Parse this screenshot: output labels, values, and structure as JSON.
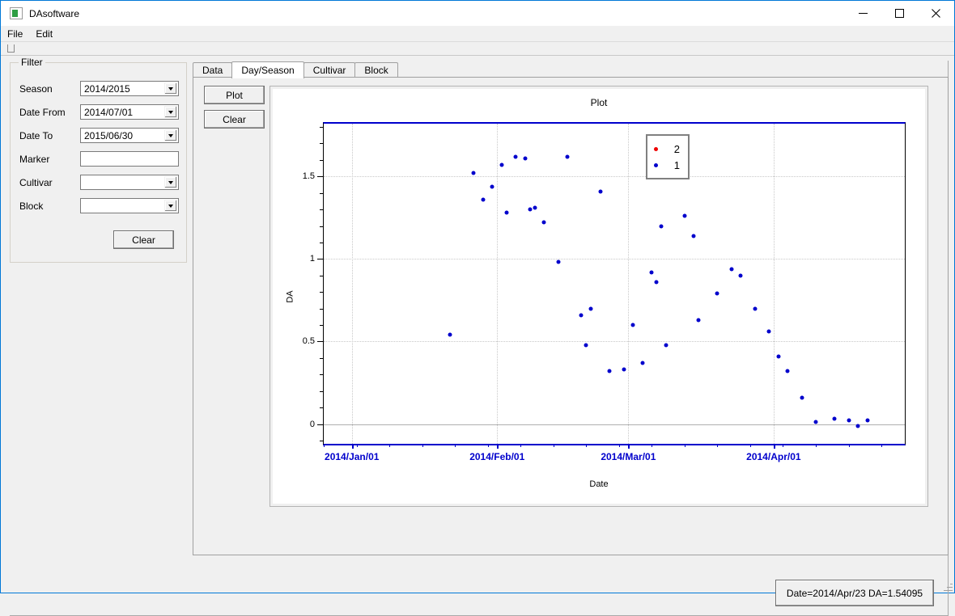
{
  "window": {
    "title": "DAsoftware",
    "icon": "app-icon",
    "minimize": "minimize-icon",
    "maximize": "maximize-icon",
    "close": "close-icon"
  },
  "menu": {
    "items": [
      "File",
      "Edit"
    ]
  },
  "filter": {
    "legend": "Filter",
    "rows": [
      {
        "label": "Season",
        "value": "2014/2015",
        "type": "combo"
      },
      {
        "label": "Date From",
        "value": "2014/07/01",
        "type": "combo"
      },
      {
        "label": "Date To",
        "value": "2015/06/30",
        "type": "combo"
      },
      {
        "label": "Marker",
        "value": "",
        "type": "text"
      },
      {
        "label": "Cultivar",
        "value": "",
        "type": "combo"
      },
      {
        "label": "Block",
        "value": "",
        "type": "combo"
      }
    ],
    "clear_label": "Clear"
  },
  "tabs": [
    {
      "label": "Data",
      "active": false
    },
    {
      "label": "Day/Season",
      "active": true
    },
    {
      "label": "Cultivar",
      "active": false
    },
    {
      "label": "Block",
      "active": false
    }
  ],
  "actions": {
    "plot_label": "Plot",
    "clear_label": "Clear"
  },
  "readout": {
    "text": "Date=2014/Apr/23  DA=1.54095"
  },
  "colors": {
    "series1": "#0000cc",
    "series2": "#ee0000",
    "axis_blue": "#0000cc",
    "grid": "#c8c8c8"
  },
  "chart_data": {
    "type": "scatter",
    "title": "Plot",
    "xlabel": "Date",
    "ylabel": "DA",
    "grid": true,
    "legend_position": "top-center-right",
    "ylim": [
      -0.12,
      1.82
    ],
    "yticks": [
      0,
      0.5,
      1,
      1.5
    ],
    "ytick_labels": [
      "0",
      "0.5",
      "1",
      "1.5"
    ],
    "xlim_days": [
      -6,
      118
    ],
    "xticks_days": [
      0,
      31,
      59,
      90
    ],
    "xtick_labels": [
      "2014/Jan/01",
      "2014/Feb/01",
      "2014/Mar/01",
      "2014/Apr/01"
    ],
    "xminor_step_days": 7,
    "series": [
      {
        "name": "2",
        "color": "#ee0000",
        "points": []
      },
      {
        "name": "1",
        "color": "#0000cc",
        "points": [
          {
            "day": 21,
            "da": 0.54
          },
          {
            "day": 26,
            "da": 1.52
          },
          {
            "day": 28,
            "da": 1.36
          },
          {
            "day": 30,
            "da": 1.44
          },
          {
            "day": 32,
            "da": 1.57
          },
          {
            "day": 33,
            "da": 1.28
          },
          {
            "day": 35,
            "da": 1.62
          },
          {
            "day": 37,
            "da": 1.61
          },
          {
            "day": 38,
            "da": 1.3
          },
          {
            "day": 39,
            "da": 1.31
          },
          {
            "day": 41,
            "da": 1.22
          },
          {
            "day": 44,
            "da": 0.98
          },
          {
            "day": 46,
            "da": 1.62
          },
          {
            "day": 49,
            "da": 0.66
          },
          {
            "day": 50,
            "da": 0.48
          },
          {
            "day": 51,
            "da": 0.7
          },
          {
            "day": 53,
            "da": 1.41
          },
          {
            "day": 55,
            "da": 0.32
          },
          {
            "day": 58,
            "da": 0.33
          },
          {
            "day": 60,
            "da": 0.6
          },
          {
            "day": 62,
            "da": 0.37
          },
          {
            "day": 64,
            "da": 0.92
          },
          {
            "day": 65,
            "da": 0.86
          },
          {
            "day": 66,
            "da": 1.2
          },
          {
            "day": 67,
            "da": 0.48
          },
          {
            "day": 71,
            "da": 1.26
          },
          {
            "day": 73,
            "da": 1.14
          },
          {
            "day": 74,
            "da": 0.63
          },
          {
            "day": 78,
            "da": 0.79
          },
          {
            "day": 81,
            "da": 0.94
          },
          {
            "day": 83,
            "da": 0.9
          },
          {
            "day": 86,
            "da": 0.7
          },
          {
            "day": 89,
            "da": 0.56
          },
          {
            "day": 91,
            "da": 0.41
          },
          {
            "day": 93,
            "da": 0.32
          },
          {
            "day": 96,
            "da": 0.16
          },
          {
            "day": 99,
            "da": 0.01
          },
          {
            "day": 103,
            "da": 0.03
          },
          {
            "day": 106,
            "da": 0.02
          },
          {
            "day": 108,
            "da": -0.01
          },
          {
            "day": 110,
            "da": 0.02
          }
        ]
      }
    ]
  }
}
